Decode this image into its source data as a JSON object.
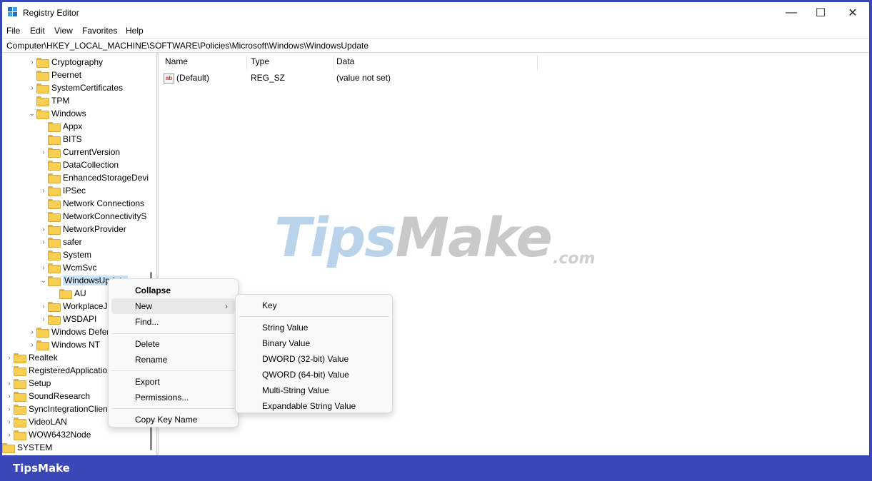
{
  "window": {
    "title": "Registry Editor",
    "minimize": "—",
    "maximize": "☐",
    "close": "✕"
  },
  "menubar": [
    "File",
    "Edit",
    "View",
    "Favorites",
    "Help"
  ],
  "address": "Computer\\HKEY_LOCAL_MACHINE\\SOFTWARE\\Policies\\Microsoft\\Windows\\WindowsUpdate",
  "tree": [
    {
      "label": "Cryptography",
      "expander": "›"
    },
    {
      "label": "Peernet",
      "expander": ""
    },
    {
      "label": "SystemCertificates",
      "expander": "›"
    },
    {
      "label": "TPM",
      "expander": ""
    },
    {
      "label": "Windows",
      "expander": "⌄"
    },
    {
      "label": "Appx",
      "expander": ""
    },
    {
      "label": "BITS",
      "expander": ""
    },
    {
      "label": "CurrentVersion",
      "expander": "›"
    },
    {
      "label": "DataCollection",
      "expander": ""
    },
    {
      "label": "EnhancedStorageDevi",
      "expander": ""
    },
    {
      "label": "IPSec",
      "expander": "›"
    },
    {
      "label": "Network Connections",
      "expander": ""
    },
    {
      "label": "NetworkConnectivityS",
      "expander": ""
    },
    {
      "label": "NetworkProvider",
      "expander": "›"
    },
    {
      "label": "safer",
      "expander": "›"
    },
    {
      "label": "System",
      "expander": ""
    },
    {
      "label": "WcmSvc",
      "expander": "›"
    },
    {
      "label": "WindowsUpdate",
      "expander": "⌄"
    },
    {
      "label": "AU",
      "expander": ""
    },
    {
      "label": "WorkplaceJo",
      "expander": "›"
    },
    {
      "label": "WSDAPI",
      "expander": "›"
    },
    {
      "label": "Windows Defer",
      "expander": "›"
    },
    {
      "label": "Windows NT",
      "expander": "›"
    },
    {
      "label": "Realtek",
      "expander": "›"
    },
    {
      "label": "RegisteredApplication",
      "expander": ""
    },
    {
      "label": "Setup",
      "expander": "›"
    },
    {
      "label": "SoundResearch",
      "expander": "›"
    },
    {
      "label": "SyncIntegrationClient",
      "expander": "›"
    },
    {
      "label": "VideoLAN",
      "expander": "›"
    },
    {
      "label": "WOW6432Node",
      "expander": "›"
    },
    {
      "label": "SYSTEM",
      "expander": ""
    }
  ],
  "list": {
    "headers": {
      "name": "Name",
      "type": "Type",
      "data": "Data"
    },
    "rows": [
      {
        "icon": "ab",
        "name": "(Default)",
        "type": "REG_SZ",
        "data": "(value not set)"
      }
    ]
  },
  "context_menu": {
    "collapse": "Collapse",
    "new": "New",
    "new_arrow": "›",
    "find": "Find...",
    "delete": "Delete",
    "rename": "Rename",
    "export": "Export",
    "permissions": "Permissions...",
    "copy_key_name": "Copy Key Name"
  },
  "submenu": {
    "key": "Key",
    "string_value": "String Value",
    "binary_value": "Binary Value",
    "dword_value": "DWORD (32-bit) Value",
    "qword_value": "QWORD (64-bit) Value",
    "multi_string_value": "Multi-String Value",
    "expandable_string_value": "Expandable String Value"
  },
  "watermark": {
    "tips": "Tips",
    "make": "Make",
    "com": ".com"
  },
  "footer": {
    "brand": "TipsMake"
  },
  "colors": {
    "frame": "#3a47b8",
    "folder": "#f7cf52",
    "selection": "#cce4f7",
    "watermark_blue": "#b8d3ea"
  }
}
